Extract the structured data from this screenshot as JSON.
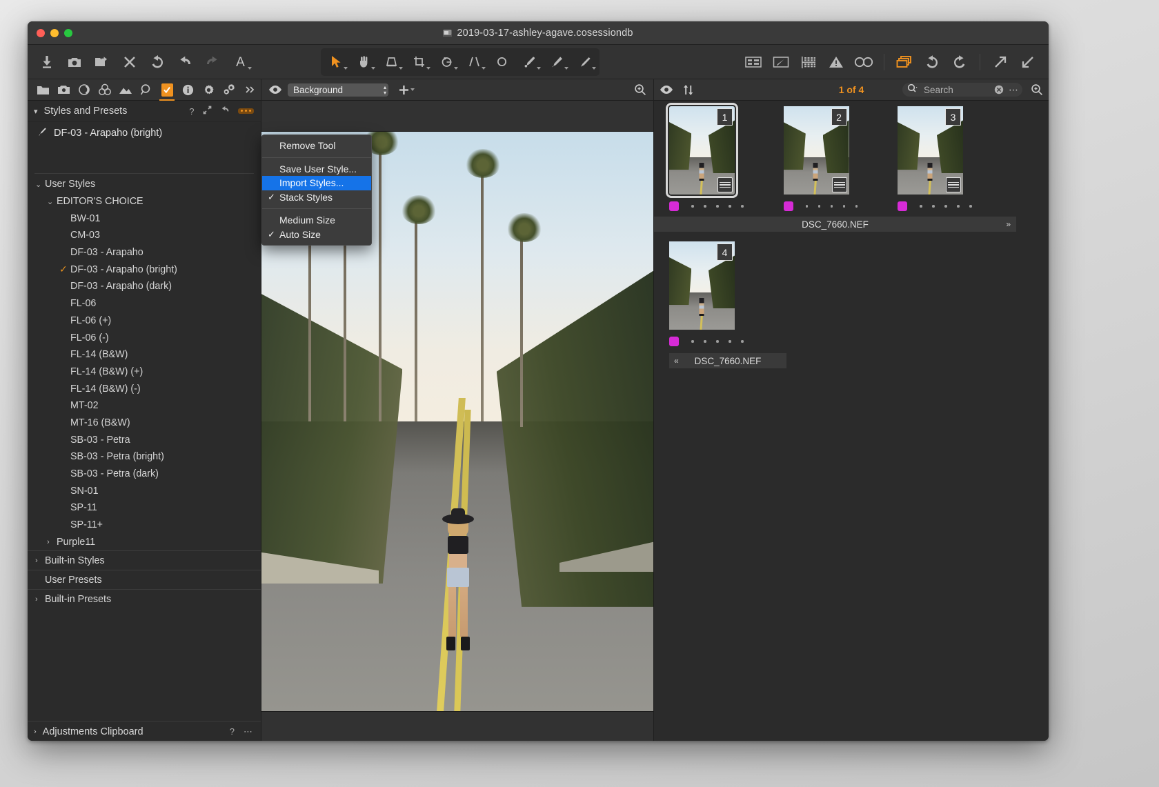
{
  "window": {
    "title": "2019-03-17-ashley-agave.cosessiondb",
    "traffic_lights": [
      "close",
      "minimize",
      "zoom"
    ]
  },
  "main_toolbar": {
    "left_group": [
      {
        "name": "import-icon",
        "label": "Import"
      },
      {
        "name": "camera-icon",
        "label": "Capture"
      },
      {
        "name": "move-to-folder-icon",
        "label": "Move to Folder"
      },
      {
        "name": "delete-icon",
        "label": "Delete"
      },
      {
        "name": "reset-icon",
        "label": "Reset"
      },
      {
        "name": "undo-icon",
        "label": "Undo"
      },
      {
        "name": "redo-icon",
        "label": "Redo"
      },
      {
        "name": "annotate-text-icon",
        "label": "A"
      }
    ],
    "center_group": [
      {
        "name": "pointer-tool-icon",
        "label": "Select",
        "active": true
      },
      {
        "name": "pan-tool-icon",
        "label": "Pan"
      },
      {
        "name": "keystone-tool-icon",
        "label": "Keystone"
      },
      {
        "name": "crop-tool-icon",
        "label": "Crop"
      },
      {
        "name": "rotate-tool-icon",
        "label": "Rotate"
      },
      {
        "name": "straighten-tool-icon",
        "label": "Straighten"
      },
      {
        "name": "spot-removal-tool-icon",
        "label": "Spot Removal"
      },
      {
        "name": "heal-brush-tool-icon",
        "label": "Heal"
      },
      {
        "name": "clone-brush-tool-icon",
        "label": "Clone"
      },
      {
        "name": "draw-mask-tool-icon",
        "label": "Draw Mask"
      }
    ],
    "right_group": [
      {
        "name": "metadata-panel-icon",
        "label": "Metadata"
      },
      {
        "name": "annotations-icon",
        "label": "Annotations"
      },
      {
        "name": "grid-overlay-icon",
        "label": "Grid"
      },
      {
        "name": "warning-icon",
        "label": "Clipping Warning"
      },
      {
        "name": "focus-mask-icon",
        "label": "Focus Mask"
      },
      {
        "name": "stack-icon",
        "label": "Variants",
        "active": true
      },
      {
        "name": "undo-arrow-icon",
        "label": "Undo"
      },
      {
        "name": "redo-arrow-icon",
        "label": "Redo"
      },
      {
        "name": "export-icon",
        "label": "Export"
      },
      {
        "name": "process-icon",
        "label": "Process"
      }
    ]
  },
  "tool_tabs": [
    {
      "name": "tab-library",
      "icon": "folder-icon",
      "selected": false
    },
    {
      "name": "tab-capture",
      "icon": "camera-icon",
      "selected": false
    },
    {
      "name": "tab-lens",
      "icon": "lens-icon",
      "selected": false
    },
    {
      "name": "tab-color",
      "icon": "color-wheels-icon",
      "selected": false
    },
    {
      "name": "tab-exposure",
      "icon": "exposure-icon",
      "selected": false
    },
    {
      "name": "tab-details",
      "icon": "magnifier-icon",
      "selected": false
    },
    {
      "name": "tab-adjustments",
      "icon": "clipboard-check-icon",
      "selected": true
    },
    {
      "name": "tab-metadata",
      "icon": "info-icon",
      "selected": false
    },
    {
      "name": "tab-output",
      "icon": "gear-icon",
      "selected": false
    },
    {
      "name": "tab-batch",
      "icon": "gears-icon",
      "selected": false
    },
    {
      "name": "tab-overflow",
      "icon": "chevron-double-right-icon",
      "selected": false
    }
  ],
  "panel": {
    "title": "Styles and Presets",
    "help_label": "?",
    "popout_label": "popout-icon",
    "reset_label": "reset-icon",
    "more_label": "more-icon",
    "current_style": "DF-03 - Arapaho (bright)",
    "rows": [
      {
        "label": "User Styles",
        "level": 0,
        "chevron": "⌄",
        "section": false,
        "checked": false
      },
      {
        "label": "EDITOR'S CHOICE",
        "level": 1,
        "chevron": "⌄",
        "section": false,
        "checked": false
      },
      {
        "label": "BW-01",
        "level": 2,
        "chevron": "",
        "section": false,
        "checked": false
      },
      {
        "label": "CM-03",
        "level": 2,
        "chevron": "",
        "section": false,
        "checked": false
      },
      {
        "label": "DF-03 - Arapaho",
        "level": 2,
        "chevron": "",
        "section": false,
        "checked": false
      },
      {
        "label": "DF-03 - Arapaho (bright)",
        "level": 2,
        "chevron": "",
        "section": false,
        "checked": true
      },
      {
        "label": "DF-03 - Arapaho (dark)",
        "level": 2,
        "chevron": "",
        "section": false,
        "checked": false
      },
      {
        "label": "FL-06",
        "level": 2,
        "chevron": "",
        "section": false,
        "checked": false
      },
      {
        "label": "FL-06 (+)",
        "level": 2,
        "chevron": "",
        "section": false,
        "checked": false
      },
      {
        "label": "FL-06 (-)",
        "level": 2,
        "chevron": "",
        "section": false,
        "checked": false
      },
      {
        "label": "FL-14 (B&W)",
        "level": 2,
        "chevron": "",
        "section": false,
        "checked": false
      },
      {
        "label": "FL-14 (B&W) (+)",
        "level": 2,
        "chevron": "",
        "section": false,
        "checked": false
      },
      {
        "label": "FL-14 (B&W) (-)",
        "level": 2,
        "chevron": "",
        "section": false,
        "checked": false
      },
      {
        "label": "MT-02",
        "level": 2,
        "chevron": "",
        "section": false,
        "checked": false
      },
      {
        "label": "MT-16 (B&W)",
        "level": 2,
        "chevron": "",
        "section": false,
        "checked": false
      },
      {
        "label": "SB-03 - Petra",
        "level": 2,
        "chevron": "",
        "section": false,
        "checked": false
      },
      {
        "label": "SB-03 - Petra (bright)",
        "level": 2,
        "chevron": "",
        "section": false,
        "checked": false
      },
      {
        "label": "SB-03 - Petra (dark)",
        "level": 2,
        "chevron": "",
        "section": false,
        "checked": false
      },
      {
        "label": "SN-01",
        "level": 2,
        "chevron": "",
        "section": false,
        "checked": false
      },
      {
        "label": "SP-11",
        "level": 2,
        "chevron": "",
        "section": false,
        "checked": false
      },
      {
        "label": "SP-11+",
        "level": 2,
        "chevron": "",
        "section": false,
        "checked": false
      },
      {
        "label": "Purple11",
        "level": 1,
        "chevron": "›",
        "section": false,
        "checked": false
      },
      {
        "label": "Built-in Styles",
        "level": 0,
        "chevron": "›",
        "section": true,
        "checked": false
      },
      {
        "label": "User Presets",
        "level": 0,
        "chevron": "",
        "section": true,
        "checked": false
      },
      {
        "label": "Built-in Presets",
        "level": 0,
        "chevron": "›",
        "section": true,
        "checked": false
      }
    ]
  },
  "adjustments_clipboard": {
    "title": "Adjustments Clipboard",
    "help_label": "?",
    "more_label": "more-icon"
  },
  "context_menu": {
    "items": [
      {
        "label": "Remove Tool",
        "checked": false,
        "highlighted": false,
        "separator_after": true
      },
      {
        "label": "Save User Style...",
        "checked": false,
        "highlighted": false,
        "separator_after": false
      },
      {
        "label": "Import Styles...",
        "checked": false,
        "highlighted": true,
        "separator_after": false
      },
      {
        "label": "Stack Styles",
        "checked": true,
        "highlighted": false,
        "separator_after": true
      },
      {
        "label": "Medium Size",
        "checked": false,
        "highlighted": false,
        "separator_after": false
      },
      {
        "label": "Auto Size",
        "checked": true,
        "highlighted": false,
        "separator_after": false
      }
    ]
  },
  "viewer": {
    "eye_icon": "eye-icon",
    "layer_value": "Background",
    "add_label": "add-layer-icon",
    "zoom_icon": "magnifier-plus-icon"
  },
  "browser": {
    "eye_icon": "eye-icon",
    "sort_icon": "sort-arrows-icon",
    "count_label": "1 of 4",
    "search_icon": "search-icon",
    "search_value": "",
    "search_placeholder": "Search",
    "clear_icon": "clear-circle-icon",
    "more_icon": "more-icon",
    "zoom_icon": "magnifier-plus-icon",
    "filename_row1": "DSC_7660.NEF",
    "filename_row2": "DSC_7660.NEF",
    "expand_right_icon": "»",
    "expand_left_icon": "«",
    "thumbnails": [
      {
        "number": "1",
        "selected": true,
        "color_label": "#d62bd6",
        "rating": 0,
        "has_adjustments": true
      },
      {
        "number": "2",
        "selected": false,
        "color_label": "#d62bd6",
        "rating": 0,
        "has_adjustments": true
      },
      {
        "number": "3",
        "selected": false,
        "color_label": "#d62bd6",
        "rating": 0,
        "has_adjustments": true
      },
      {
        "number": "4",
        "selected": false,
        "color_label": "#d62bd6",
        "rating": 0,
        "has_adjustments": false
      }
    ]
  },
  "colors": {
    "accent": "#f09220",
    "menu_highlight": "#1573e8",
    "color_label": "#d62bd6",
    "panel_bg": "#2b2b2b",
    "toolbar_bg": "#333333"
  }
}
